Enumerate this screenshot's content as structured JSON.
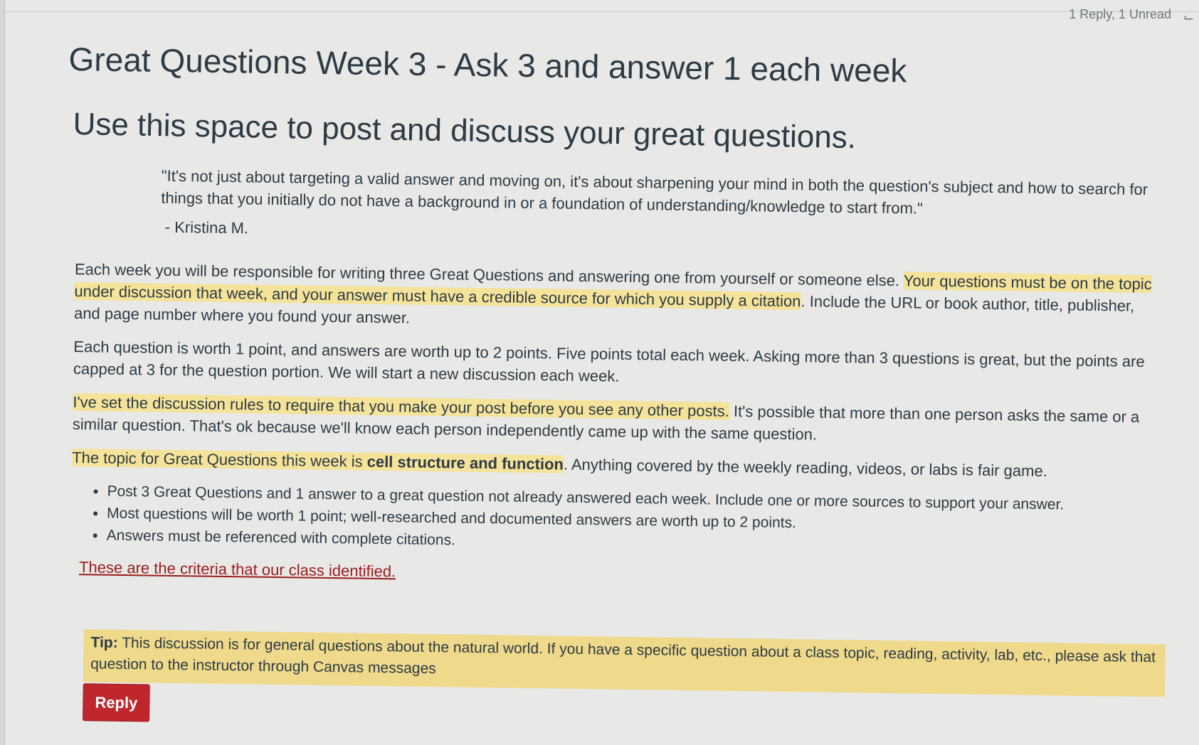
{
  "header": {
    "meta": "1 Reply, 1 Unread"
  },
  "title": "Great Questions Week 3 - Ask 3 and answer 1 each week",
  "subtitle": "Use this space to post and discuss your great questions.",
  "quote": {
    "text": "\"It's not just about targeting a valid answer and moving on, it's about sharpening your mind in both the question's subject and how to search for things that you initially do not have a background in or a foundation of understanding/knowledge to start from.\"",
    "attribution": "- Kristina M."
  },
  "para1": {
    "a": "Each week you will be responsible for writing three Great Questions and answering one from yourself or someone else. ",
    "b_highlight": "Your questions must be on the topic under discussion that week, and your answer must have a credible source for which you supply a citation",
    "c": ".  Include the URL or book author, title, publisher, and page number where you found your answer."
  },
  "para2": "Each question is worth 1 point, and answers are worth up to 2 points.  Five points total each week.  Asking more than 3 questions is great, but the points are capped at 3 for the question portion. We will start a new discussion each week.",
  "para3": {
    "a_highlight": "I've set the discussion rules to require that you make your post before you see any other posts.",
    "b": "  It's possible that more than one person asks the same or a similar question.  That's ok because we'll know each person independently came up with the same question."
  },
  "para4": {
    "a_highlight": "The topic  for Great Questions this week is ",
    "b_bold": "cell structure and function",
    "c": ".  Anything covered by the weekly reading, videos, or labs is fair game."
  },
  "bullets": [
    "Post 3 Great Questions and 1 answer to a great question not already answered each week. Include one or more sources to support your answer.",
    "Most questions will be worth 1 point; well-researched and documented answers are worth up to 2 points.",
    "Answers must be referenced with complete citations."
  ],
  "criteria_link": "These are the criteria that our class identified.",
  "tip": {
    "label": "Tip:",
    "text": " This discussion is for general questions about the natural world.  If you have a specific question about a class topic, reading, activity, lab, etc., please ask that question to the instructor through Canvas messages"
  },
  "reply_label": "Reply",
  "colors": {
    "highlight": "#f5e39a",
    "tip_bg": "#efd98a",
    "reply_bg": "#c0272d",
    "link": "#9b1c1c"
  }
}
